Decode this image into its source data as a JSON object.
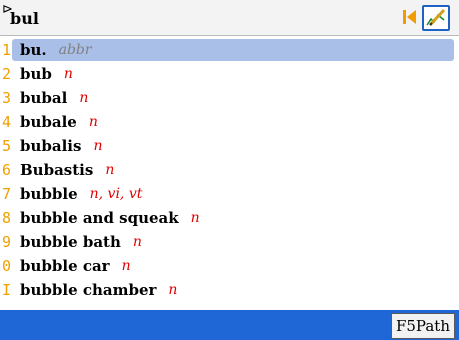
{
  "search": {
    "prompt": "⊳",
    "value": "bul"
  },
  "toolbar": {
    "skip_icon": "skip-to-start-icon",
    "edit_icon": "pen-edit-icon"
  },
  "entries": [
    {
      "num": "1",
      "word": "bu.",
      "pos": "abbr"
    },
    {
      "num": "2",
      "word": "bub",
      "pos": "n"
    },
    {
      "num": "3",
      "word": "bubal",
      "pos": "n"
    },
    {
      "num": "4",
      "word": "bubale",
      "pos": "n"
    },
    {
      "num": "5",
      "word": "bubalis",
      "pos": "n"
    },
    {
      "num": "6",
      "word": "Bubastis",
      "pos": "n"
    },
    {
      "num": "7",
      "word": "bubble",
      "pos": "n, vi, vt"
    },
    {
      "num": "8",
      "word": "bubble and squeak",
      "pos": "n"
    },
    {
      "num": "9",
      "word": "bubble bath",
      "pos": "n"
    },
    {
      "num": "0",
      "word": "bubble car",
      "pos": "n"
    },
    {
      "num": "I",
      "word": "bubble chamber",
      "pos": "n"
    }
  ],
  "statusbar": {
    "button_label": "F5Path"
  },
  "colors": {
    "accent": "#1f66d6",
    "selection": "#aabfe8",
    "index": "#f0a000",
    "pos": "#e00000"
  }
}
